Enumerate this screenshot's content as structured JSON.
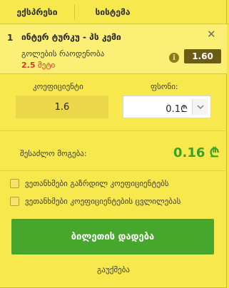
{
  "tabs": [
    {
      "label": "ექსპრესი",
      "active": true
    },
    {
      "label": "სისტემა",
      "active": false
    }
  ],
  "bet": {
    "number": "1",
    "event": "ინტერ ტურკუ - პს კემი",
    "market": "გოლების რაოდენობა",
    "selection_value": "2.5",
    "selection_label": "მეტი",
    "odds": "1.60",
    "info_icon": "i"
  },
  "stake": {
    "coefficient_label": "კოეფიციენტი",
    "coefficient_value": "1.6",
    "stake_label": "ფსონი:",
    "stake_value": "0.1₾"
  },
  "winnings": {
    "label": "შესაძლო მოგება:",
    "value": "0.16 ₾"
  },
  "options": [
    {
      "label": "ვეთანხმები გაზრდილ კოეფიციენტებს",
      "checked": false
    },
    {
      "label": "ვეთანხმები კოეფიციენტების ცვლილებას",
      "checked": false
    }
  ],
  "actions": {
    "place_bet": "ბილეთის დადება",
    "clear": "გაუქმება"
  },
  "colors": {
    "background": "#f7e94d",
    "odds_box": "#6b5b16",
    "win_value": "#3b9f2a",
    "place_button": "#47a62c",
    "selection": "#d03a2a"
  }
}
